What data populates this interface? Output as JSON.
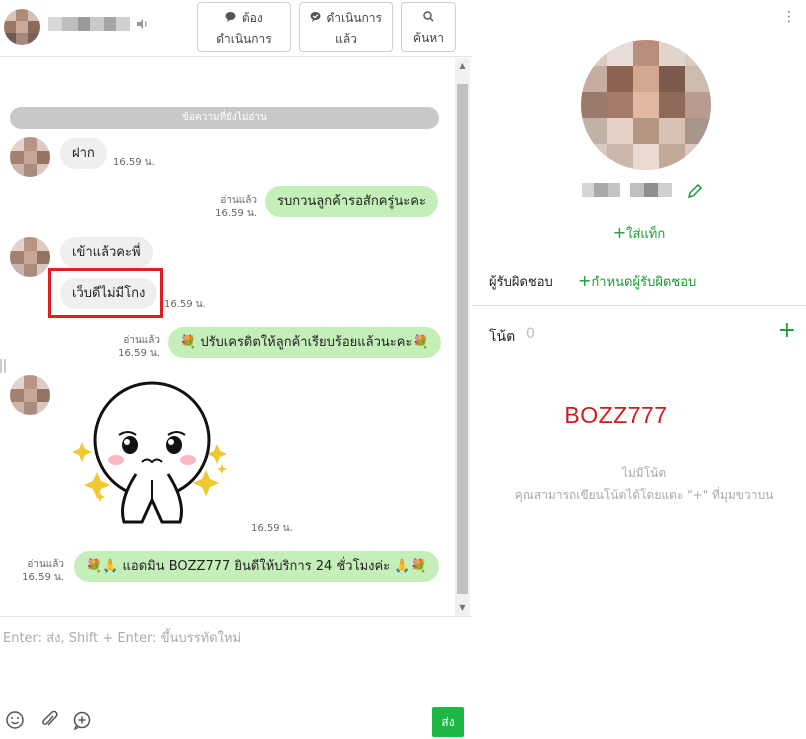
{
  "header": {
    "speaker_icon": "speaker-icon",
    "todo_label": "ต้อง ดำเนินการ",
    "done_label": "ดำเนินการ แล้ว",
    "search_label": "ค้นหา"
  },
  "chat": {
    "unread_divider": "ข้อความที่ยังไม่อ่าน",
    "messages": [
      {
        "side": "in",
        "text": "ฝาก",
        "time": "16.59 น."
      },
      {
        "side": "out",
        "text": "รบกวนลูกค้ารอสักครู่นะคะ",
        "read": "อ่านแล้ว",
        "time": "16.59 น."
      },
      {
        "side": "in",
        "text": "เข้าแล้วคะพี่"
      },
      {
        "side": "in",
        "text": "เว็บดีไม่มีโกง",
        "time": "16.59 น.",
        "highlighted": true
      },
      {
        "side": "out",
        "text": "💐 ปรับเครดิตให้ลูกค้าเรียบร้อยแล้วนะคะ💐",
        "read": "อ่านแล้ว",
        "time": "16.59 น."
      },
      {
        "side": "in",
        "type": "sticker",
        "sticker_name": "moon-pleading-sticker",
        "time": "16.59 น."
      },
      {
        "side": "out",
        "text": "💐🙏 แอดมิน BOZZ777 ยินดีให้บริการ 24 ชั่วโมงค่ะ 🙏💐",
        "read": "อ่านแล้ว",
        "time": "16.59 น."
      }
    ]
  },
  "composer": {
    "placeholder": "Enter: ส่ง, Shift + Enter: ขึ้นบรรทัดใหม่",
    "send_label": "ส่ง",
    "icons": [
      "emoji-icon",
      "attachment-icon",
      "add-comment-icon"
    ]
  },
  "profile": {
    "add_tag_label": "ใส่แท็ก",
    "assignee_label": "ผู้รับผิดชอบ",
    "assign_link_label": "กำหนดผู้รับผิดชอบ",
    "notes_label": "โน้ต",
    "notes_count": "0",
    "watermark": "BOZZ777",
    "no_notes": "ไม่มีโน้ต",
    "no_notes_hint": "คุณสามารถเขียนโน้ตได้โดยแตะ \"+\" ที่มุมขวาบน"
  },
  "colors": {
    "accent_green": "#1a9a34",
    "send_green": "#1db746",
    "outgoing_bubble": "#c5efb9",
    "incoming_bubble": "#efefef",
    "highlight_red": "#e02020",
    "watermark_red": "#d01b1b"
  }
}
